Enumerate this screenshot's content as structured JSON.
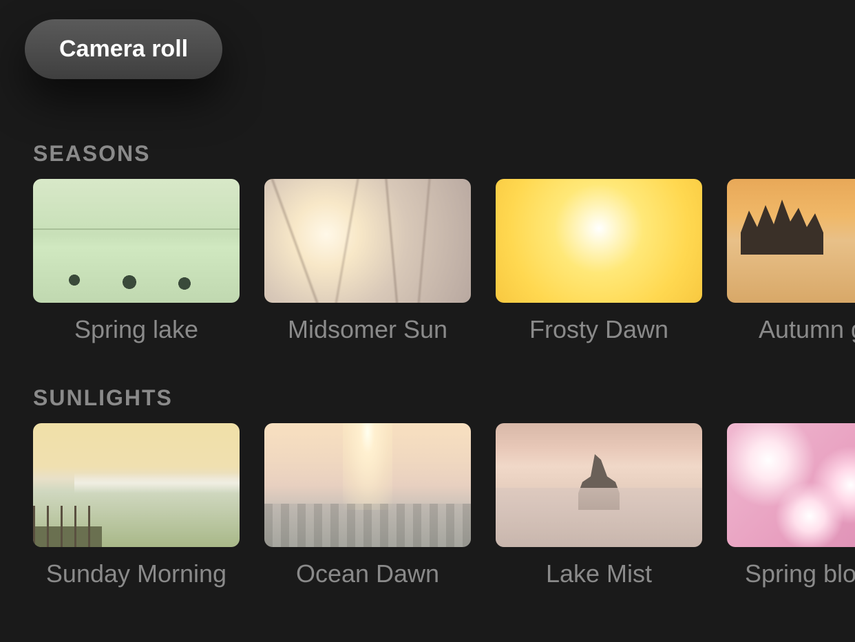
{
  "camera_roll_label": "Camera roll",
  "sections": [
    {
      "title": "SEASONS",
      "items": [
        {
          "label": "Spring lake"
        },
        {
          "label": "Midsomer Sun"
        },
        {
          "label": "Frosty Dawn"
        },
        {
          "label": "Autumn glow"
        }
      ]
    },
    {
      "title": "SUNLIGHTS",
      "items": [
        {
          "label": "Sunday Morning"
        },
        {
          "label": "Ocean Dawn"
        },
        {
          "label": "Lake Mist"
        },
        {
          "label": "Spring blossom"
        }
      ]
    }
  ]
}
